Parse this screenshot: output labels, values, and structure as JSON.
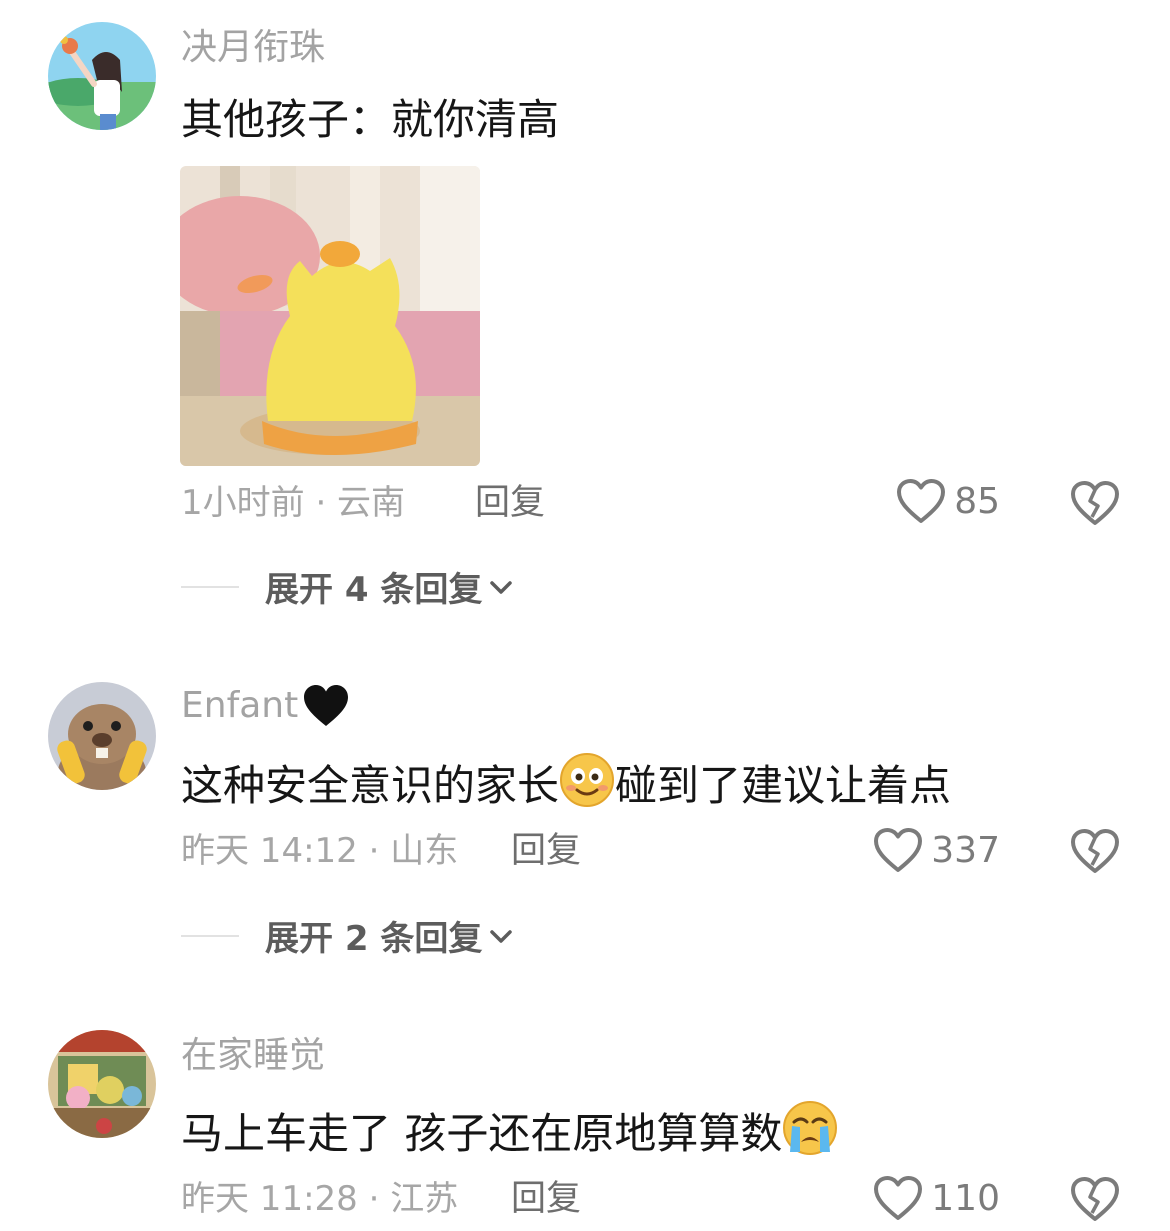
{
  "comments": [
    {
      "username": "决月衔珠",
      "text": "其他孩子：就你清高",
      "time_location": "1小时前 · 云南",
      "reply_label": "回复",
      "likes": "85",
      "expand_label": "展开 4 条回复",
      "has_image": true,
      "image_icon": "yellow-plush-figure-image"
    },
    {
      "username": "Enfant",
      "username_emoji": "black-heart-icon",
      "text_before_emoji": "这种安全意识的家长",
      "text_emoji": "smiling-face-emoji",
      "text_after_emoji": "碰到了建议让着点",
      "time_location": "昨天 14:12 · 山东",
      "reply_label": "回复",
      "likes": "337",
      "expand_label": "展开 2 条回复"
    },
    {
      "username": "在家睡觉",
      "text_before_emoji": "马上车走了 孩子还在原地算算数",
      "text_emoji": "crying-face-emoji",
      "time_location": "昨天 11:28 · 江苏",
      "reply_label": "回复",
      "likes": "110"
    }
  ],
  "icons": {
    "like": "heart-outline-icon",
    "dislike": "broken-heart-icon",
    "expand": "chevron-down-icon"
  },
  "colors": {
    "username": "#a3a3a3",
    "text": "#161616",
    "meta": "#a6a6a6",
    "expand": "#5c5c5c"
  }
}
